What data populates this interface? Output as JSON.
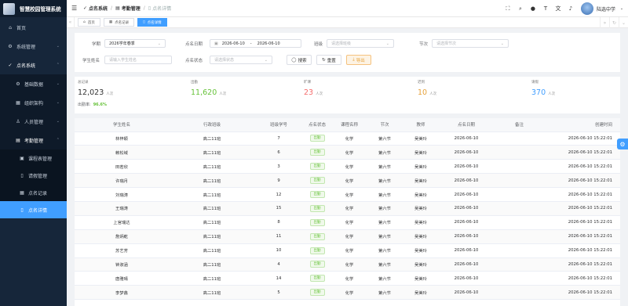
{
  "app": {
    "title": "智慧校园管理系统"
  },
  "sidebar": {
    "items": [
      {
        "label": "首页",
        "icon": "home-icon"
      },
      {
        "label": "系统管理",
        "icon": "gear-icon"
      },
      {
        "label": "点名系统",
        "icon": "check-icon"
      },
      {
        "label": "基础数据",
        "icon": "gear-icon"
      },
      {
        "label": "组织架构",
        "icon": "grid-icon"
      },
      {
        "label": "人员管理",
        "icon": "user-icon"
      },
      {
        "label": "考勤管理",
        "icon": "book-icon"
      },
      {
        "label": "课程表管理",
        "icon": "calendar-icon"
      },
      {
        "label": "请假管理",
        "icon": "document-icon"
      },
      {
        "label": "点名记录",
        "icon": "list-icon"
      },
      {
        "label": "点名详情",
        "icon": "document-icon"
      }
    ]
  },
  "breadcrumb": {
    "l1": "点名系统",
    "l2": "考勤管理",
    "l3": "点名详情"
  },
  "user": {
    "name": "陆选中学"
  },
  "tabs": [
    {
      "label": "首页"
    },
    {
      "label": "点名记录"
    },
    {
      "label": "点名详情"
    }
  ],
  "filter": {
    "semester_label": "学期",
    "semester_value": "2026学年春季",
    "date_label": "点名日期",
    "date_start": "2026-06-10",
    "date_sep": "-",
    "date_end": "2026-06-10",
    "class_label": "班级",
    "class_placeholder": "请选择班级",
    "period_label": "节次",
    "period_placeholder": "请选择节次",
    "name_label": "学生姓名",
    "name_placeholder": "请输入学生姓名",
    "status_label": "点名状态",
    "status_placeholder": "请选择状态",
    "search_btn": "搜索",
    "reset_btn": "重置",
    "export_btn": "导出"
  },
  "stats": [
    {
      "label": "总记录",
      "value": "12,023",
      "unit": "人次",
      "color": "#303133"
    },
    {
      "label": "出勤",
      "value": "11,620",
      "unit": "人次",
      "color": "#67c23a"
    },
    {
      "label": "旷课",
      "value": "23",
      "unit": "人次",
      "color": "#f56c6c"
    },
    {
      "label": "迟到",
      "value": "10",
      "unit": "人次",
      "color": "#e6a23c"
    },
    {
      "label": "请假",
      "value": "370",
      "unit": "人次",
      "color": "#409eff"
    }
  ],
  "rate": {
    "label": "出勤率:",
    "value": "96.6%"
  },
  "table": {
    "headers": [
      "学生姓名",
      "行政班级",
      "班级学号",
      "点名状态",
      "课程名称",
      "节次",
      "教师",
      "点名日期",
      "备注",
      "创建时间"
    ],
    "rows": [
      [
        "林梓颖",
        "高二11班",
        "7",
        "出勤",
        "化学",
        "第六节",
        "吴美玲",
        "2026-06-10",
        "",
        "2026-06-10 15:22:01"
      ],
      [
        "赖松域",
        "高二11班",
        "6",
        "出勤",
        "化学",
        "第六节",
        "吴美玲",
        "2026-06-10",
        "",
        "2026-06-10 15:22:01"
      ],
      [
        "田若欣",
        "高二11班",
        "3",
        "出勤",
        "化学",
        "第六节",
        "吴美玲",
        "2026-06-10",
        "",
        "2026-06-10 15:22:01"
      ],
      [
        "许瑞月",
        "高二11班",
        "9",
        "出勤",
        "化学",
        "第六节",
        "吴美玲",
        "2026-06-10",
        "",
        "2026-06-10 15:22:01"
      ],
      [
        "刘瑞涛",
        "高二11班",
        "12",
        "出勤",
        "化学",
        "第六节",
        "吴美玲",
        "2026-06-10",
        "",
        "2026-06-10 15:22:01"
      ],
      [
        "王瑞涛",
        "高二11班",
        "15",
        "出勤",
        "化学",
        "第六节",
        "吴美玲",
        "2026-06-10",
        "",
        "2026-06-10 15:22:01"
      ],
      [
        "上官瑞达",
        "高二11班",
        "8",
        "出勤",
        "化学",
        "第六节",
        "吴美玲",
        "2026-06-10",
        "",
        "2026-06-10 15:22:01"
      ],
      [
        "詹炳乾",
        "高二11班",
        "11",
        "出勤",
        "化学",
        "第六节",
        "吴美玲",
        "2026-06-10",
        "",
        "2026-06-10 15:22:01"
      ],
      [
        "苏艺芳",
        "高二11班",
        "10",
        "出勤",
        "化学",
        "第六节",
        "吴美玲",
        "2026-06-10",
        "",
        "2026-06-10 15:22:01"
      ],
      [
        "钟淑涵",
        "高二11班",
        "4",
        "出勤",
        "化学",
        "第六节",
        "吴美玲",
        "2026-06-10",
        "",
        "2026-06-10 15:22:01"
      ],
      [
        "唐雅晴",
        "高二11班",
        "14",
        "出勤",
        "化学",
        "第六节",
        "吴美玲",
        "2026-06-10",
        "",
        "2026-06-10 15:22:01"
      ],
      [
        "李梦鑫",
        "高二11班",
        "5",
        "出勤",
        "化学",
        "第六节",
        "吴美玲",
        "2026-06-10",
        "",
        "2026-06-10 15:22:01"
      ]
    ]
  }
}
